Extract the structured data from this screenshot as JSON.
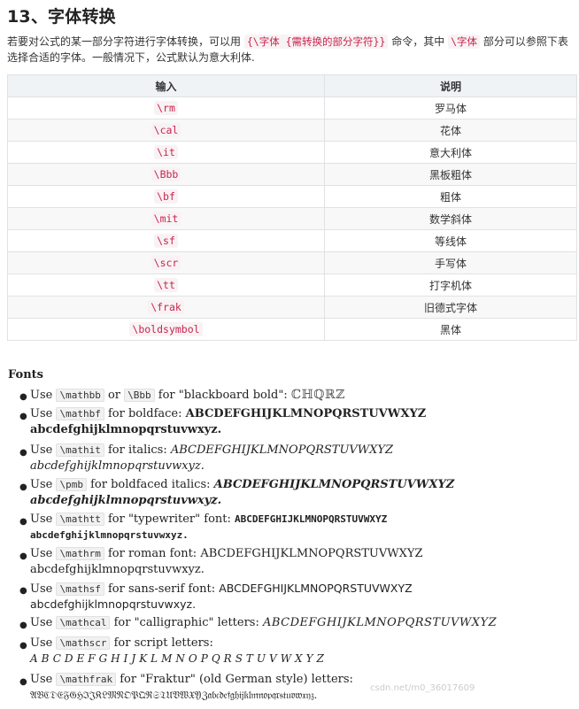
{
  "heading": "13、字体转换",
  "intro": {
    "p1": "若要对公式的某一部分字符进行字体转换，可以用",
    "code1": "{\\字体 {需转换的部分字符}}",
    "p2": "命令，其中",
    "code2": "\\字体",
    "p3": "部分可以参照下表",
    "line2": "选择合适的字体。一般情况下，公式默认为意大利体."
  },
  "table": {
    "headers": [
      "输入",
      "说明"
    ],
    "rows": [
      {
        "cmd": "\\rm",
        "desc": "罗马体"
      },
      {
        "cmd": "\\cal",
        "desc": "花体"
      },
      {
        "cmd": "\\it",
        "desc": "意大利体"
      },
      {
        "cmd": "\\Bbb",
        "desc": "黑板粗体"
      },
      {
        "cmd": "\\bf",
        "desc": "粗体"
      },
      {
        "cmd": "\\mit",
        "desc": "数学斜体"
      },
      {
        "cmd": "\\sf",
        "desc": "等线体"
      },
      {
        "cmd": "\\scr",
        "desc": "手写体"
      },
      {
        "cmd": "\\tt",
        "desc": "打字机体"
      },
      {
        "cmd": "\\frak",
        "desc": "旧德式字体"
      },
      {
        "cmd": "\\boldsymbol",
        "desc": "黑体"
      }
    ]
  },
  "fonts": {
    "title": "Fonts",
    "items": [
      {
        "pre": "Use",
        "codes": [
          "\\mathbb",
          "\\Bbb"
        ],
        "mid": "or",
        "post": "for \"blackboard bold\":",
        "sample": "ℂℍℚℝℤ",
        "sample2": "",
        "cls": "s-bb"
      },
      {
        "pre": "Use",
        "codes": [
          "\\mathbf"
        ],
        "post": "for boldface:",
        "sample": "ABCDEFGHIJKLMNOPQRSTUVWXYZ",
        "sample2": "abcdefghijklmnopqrstuvwxyz.",
        "cls": "s-bf"
      },
      {
        "pre": "Use",
        "codes": [
          "\\mathit"
        ],
        "post": "for italics:",
        "sample": "ABCDEFGHIJKLMNOPQRSTUVWXYZ",
        "sample2": "abcdefghijklmnopqrstuvwxyz.",
        "cls": "s-it"
      },
      {
        "pre": "Use",
        "codes": [
          "\\pmb"
        ],
        "post": "for boldfaced italics:",
        "sample": "ABCDEFGHIJKLMNOPQRSTUVWXYZ",
        "sample2": "abcdefghijklmnopqrstuvwxyz.",
        "cls": "s-pmb"
      },
      {
        "pre": "Use",
        "codes": [
          "\\mathtt"
        ],
        "post": "for \"typewriter\" font:",
        "sample": "ABCDEFGHIJKLMNOPQRSTUVWXYZ",
        "sample2": "abcdefghijklmnopqrstuvwxyz.",
        "cls": "s-tt"
      },
      {
        "pre": "Use",
        "codes": [
          "\\mathrm"
        ],
        "post": "for roman font:",
        "sample": "ABCDEFGHIJKLMNOPQRSTUVWXYZ",
        "sample2": "abcdefghijklmnopqrstuvwxyz.",
        "cls": "s-rm"
      },
      {
        "pre": "Use",
        "codes": [
          "\\mathsf"
        ],
        "post": "for sans-serif font:",
        "sample": "ABCDEFGHIJKLMNOPQRSTUVWXYZ",
        "sample2": "abcdefghijklmnopqrstuvwxyz.",
        "cls": "s-sf"
      },
      {
        "pre": "Use",
        "codes": [
          "\\mathcal"
        ],
        "post": "for \"calligraphic\" letters:",
        "sample": "ABCDEFGHIJKLMNOPQRSTUVWXYZ",
        "sample2": "",
        "cls": "s-cal"
      },
      {
        "pre": "Use",
        "codes": [
          "\\mathscr"
        ],
        "post": "for script letters:",
        "sample": "",
        "sample2": "ABCDEFGHIJKLMNOPQRSTUVWXYZ",
        "cls": "s-scr"
      },
      {
        "pre": "Use",
        "codes": [
          "\\mathfrak"
        ],
        "post": "for \"Fraktur\" (old German style) letters:",
        "sample": "",
        "sample2": "𝔄𝔅ℭ𝔇𝔈𝔉𝔊ℌℑ𝔍𝔎𝔏𝔐𝔑𝔒𝔓𝔔ℜ𝔖𝔗𝔘𝔙𝔚𝔛𝔜ℨ𝔞𝔟𝔠𝔡𝔢𝔣𝔤𝔥𝔦𝔧𝔨𝔩𝔪𝔫𝔬𝔭𝔮𝔯𝔰𝔱𝔲𝔳𝔴𝔵𝔶𝔷.",
        "cls": "s-frak"
      }
    ]
  },
  "watermark": "csdn.net/m0_36017609"
}
